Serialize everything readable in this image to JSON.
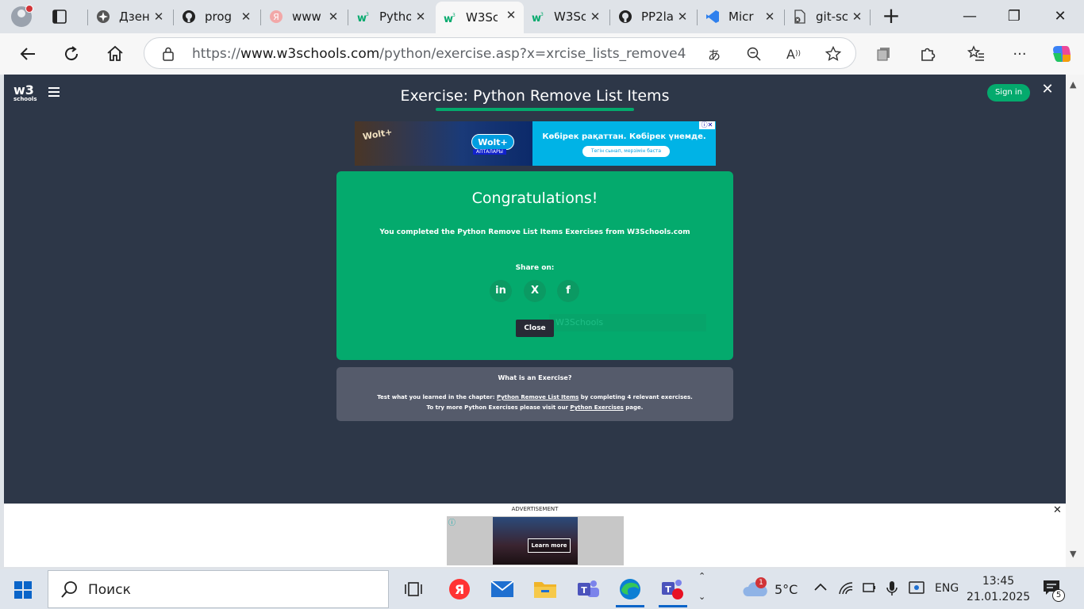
{
  "browser": {
    "tabs": [
      {
        "label": "Дзен",
        "active": false
      },
      {
        "label": "prog",
        "active": false
      },
      {
        "label": "www",
        "active": false
      },
      {
        "label": "Pytho",
        "active": false
      },
      {
        "label": "W3Sc",
        "active": true
      },
      {
        "label": "W3Sc",
        "active": false
      },
      {
        "label": "PP2la",
        "active": false
      },
      {
        "label": "Micr",
        "active": false
      },
      {
        "label": "git-sc",
        "active": false
      }
    ],
    "url_prefix": "https://",
    "url_domain": "www.w3schools.com",
    "url_path": "/python/exercise.asp?x=xrcise_lists_remove4"
  },
  "page": {
    "title": "Exercise: Python Remove List Items",
    "signin_label": "Sign in",
    "logo_w3": "w3",
    "logo_schools": "schools",
    "ad_top": {
      "brand": "Wolt+",
      "brand_small": "АПТАЛАРЫ",
      "headline": "Көбірек рақаттан. Көбірек үнемде.",
      "cta": "Тегін сынап, мерзімін баста"
    },
    "congrats": {
      "heading": "Congratulations!",
      "message": "You completed the Python Remove List Items Exercises from W3Schools.com",
      "share_label": "Share on:",
      "social": [
        "in",
        "X",
        "f"
      ],
      "close_label": "Close",
      "ghost_text": "W3Schools"
    },
    "whatis": {
      "title": "What is an Exercise?",
      "line1_pre": "Test what you learned in the chapter: ",
      "line1_link": "Python Remove List Items",
      "line1_post": " by completing 4 relevant exercises.",
      "line2_pre": "To try more Python Exercises please visit our ",
      "line2_link": "Python Exercises",
      "line2_post": " page."
    }
  },
  "bottom_ad": {
    "label": "ADVERTISEMENT",
    "cta": "Learn more"
  },
  "taskbar": {
    "search_placeholder": "Поиск",
    "weather_temp": "5°C",
    "weather_badge": "1",
    "language": "ENG",
    "time": "13:45",
    "date": "21.01.2025",
    "notification_count": "5"
  }
}
